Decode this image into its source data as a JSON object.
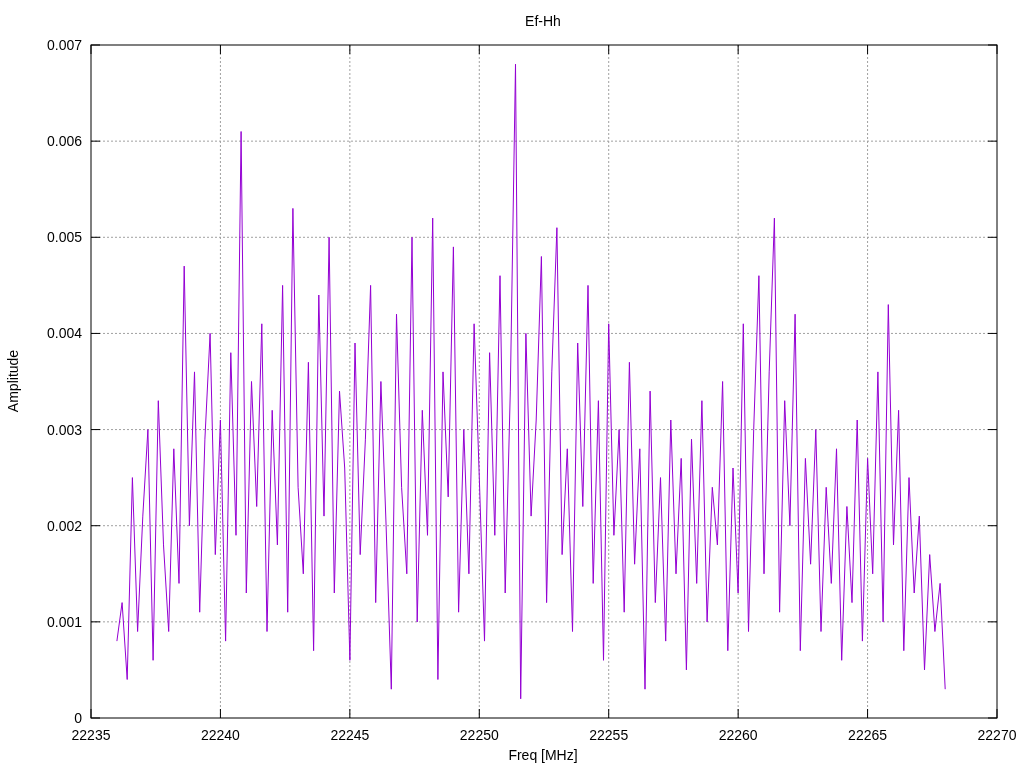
{
  "chart": {
    "chart_data": {
      "type": "line",
      "grid": true,
      "title": "Ef-Hh",
      "xlabel": "Freq [MHz]",
      "ylabel": "Amplitude",
      "xlim": [
        22235,
        22270
      ],
      "ylim": [
        0,
        0.007
      ],
      "xticks": [
        22235,
        22240,
        22245,
        22250,
        22255,
        22260,
        22265,
        22270
      ],
      "yticks": [
        0,
        0.001,
        0.002,
        0.003,
        0.004,
        0.005,
        0.006,
        0.007
      ],
      "x": [
        22236,
        22236.2,
        22236.4,
        22236.6,
        22236.8,
        22237,
        22237.2,
        22237.4,
        22237.6,
        22237.8,
        22238,
        22238.2,
        22238.4,
        22238.6,
        22238.8,
        22239,
        22239.2,
        22239.4,
        22239.6,
        22239.8,
        22240,
        22240.2,
        22240.4,
        22240.6,
        22240.8,
        22241,
        22241.2,
        22241.4,
        22241.6,
        22241.8,
        22242,
        22242.2,
        22242.4,
        22242.6,
        22242.8,
        22243,
        22243.2,
        22243.4,
        22243.6,
        22243.8,
        22244,
        22244.2,
        22244.4,
        22244.6,
        22244.8,
        22245,
        22245.2,
        22245.4,
        22245.6,
        22245.8,
        22246,
        22246.2,
        22246.4,
        22246.6,
        22246.8,
        22247,
        22247.2,
        22247.4,
        22247.6,
        22247.8,
        22248,
        22248.2,
        22248.4,
        22248.6,
        22248.8,
        22249,
        22249.2,
        22249.4,
        22249.6,
        22249.8,
        22250,
        22250.2,
        22250.4,
        22250.6,
        22250.8,
        22251,
        22251.2,
        22251.4,
        22251.6,
        22251.8,
        22252,
        22252.2,
        22252.4,
        22252.6,
        22252.8,
        22253,
        22253.2,
        22253.4,
        22253.6,
        22253.8,
        22254,
        22254.2,
        22254.4,
        22254.6,
        22254.8,
        22255,
        22255.2,
        22255.4,
        22255.6,
        22255.8,
        22256,
        22256.2,
        22256.4,
        22256.6,
        22256.8,
        22257,
        22257.2,
        22257.4,
        22257.6,
        22257.8,
        22258,
        22258.2,
        22258.4,
        22258.6,
        22258.8,
        22259,
        22259.2,
        22259.4,
        22259.6,
        22259.8,
        22260,
        22260.2,
        22260.4,
        22260.6,
        22260.8,
        22261,
        22261.2,
        22261.4,
        22261.6,
        22261.8,
        22262,
        22262.2,
        22262.4,
        22262.6,
        22262.8,
        22263,
        22263.2,
        22263.4,
        22263.6,
        22263.8,
        22264,
        22264.2,
        22264.4,
        22264.6,
        22264.8,
        22265,
        22265.2,
        22265.4,
        22265.6,
        22265.8,
        22266,
        22266.2,
        22266.4,
        22266.6,
        22266.8,
        22267,
        22267.2,
        22267.4,
        22267.6,
        22267.8,
        22268
      ],
      "series": [
        {
          "color": "#9400d3",
          "values": [
            0.0008,
            0.0012,
            0.0004,
            0.0025,
            0.0009,
            0.0021,
            0.003,
            0.0006,
            0.0033,
            0.0018,
            0.0009,
            0.0028,
            0.0014,
            0.0047,
            0.002,
            0.0036,
            0.0011,
            0.0029,
            0.004,
            0.0017,
            0.0031,
            0.0008,
            0.0038,
            0.0019,
            0.0061,
            0.0013,
            0.0035,
            0.0022,
            0.0041,
            0.0009,
            0.0032,
            0.0018,
            0.0045,
            0.0011,
            0.0053,
            0.0024,
            0.0015,
            0.0037,
            0.0007,
            0.0044,
            0.0021,
            0.005,
            0.0013,
            0.0034,
            0.0026,
            0.0006,
            0.0039,
            0.0017,
            0.0029,
            0.0045,
            0.0012,
            0.0035,
            0.002,
            0.0003,
            0.0042,
            0.0024,
            0.0015,
            0.005,
            0.001,
            0.0032,
            0.0019,
            0.0052,
            0.0004,
            0.0036,
            0.0023,
            0.0049,
            0.0011,
            0.003,
            0.0015,
            0.0041,
            0.0025,
            0.0008,
            0.0038,
            0.0019,
            0.0046,
            0.0013,
            0.0034,
            0.0068,
            0.0002,
            0.004,
            0.0021,
            0.0031,
            0.0048,
            0.0012,
            0.0036,
            0.0051,
            0.0017,
            0.0028,
            0.0009,
            0.0039,
            0.0022,
            0.0045,
            0.0014,
            0.0033,
            0.0006,
            0.0041,
            0.0019,
            0.003,
            0.0011,
            0.0037,
            0.0016,
            0.0028,
            0.0003,
            0.0034,
            0.0012,
            0.0025,
            0.0008,
            0.0031,
            0.0015,
            0.0027,
            0.0005,
            0.0029,
            0.0014,
            0.0033,
            0.001,
            0.0024,
            0.0018,
            0.0035,
            0.0007,
            0.0026,
            0.0013,
            0.0041,
            0.0009,
            0.003,
            0.0046,
            0.0015,
            0.0036,
            0.0052,
            0.0011,
            0.0033,
            0.002,
            0.0042,
            0.0007,
            0.0027,
            0.0016,
            0.003,
            0.0009,
            0.0024,
            0.0014,
            0.0028,
            0.0006,
            0.0022,
            0.0012,
            0.0031,
            0.0008,
            0.0027,
            0.0015,
            0.0036,
            0.001,
            0.0043,
            0.0018,
            0.0032,
            0.0007,
            0.0025,
            0.0013,
            0.0021,
            0.0005,
            0.0017,
            0.0009,
            0.0014,
            0.0003
          ]
        }
      ]
    }
  }
}
